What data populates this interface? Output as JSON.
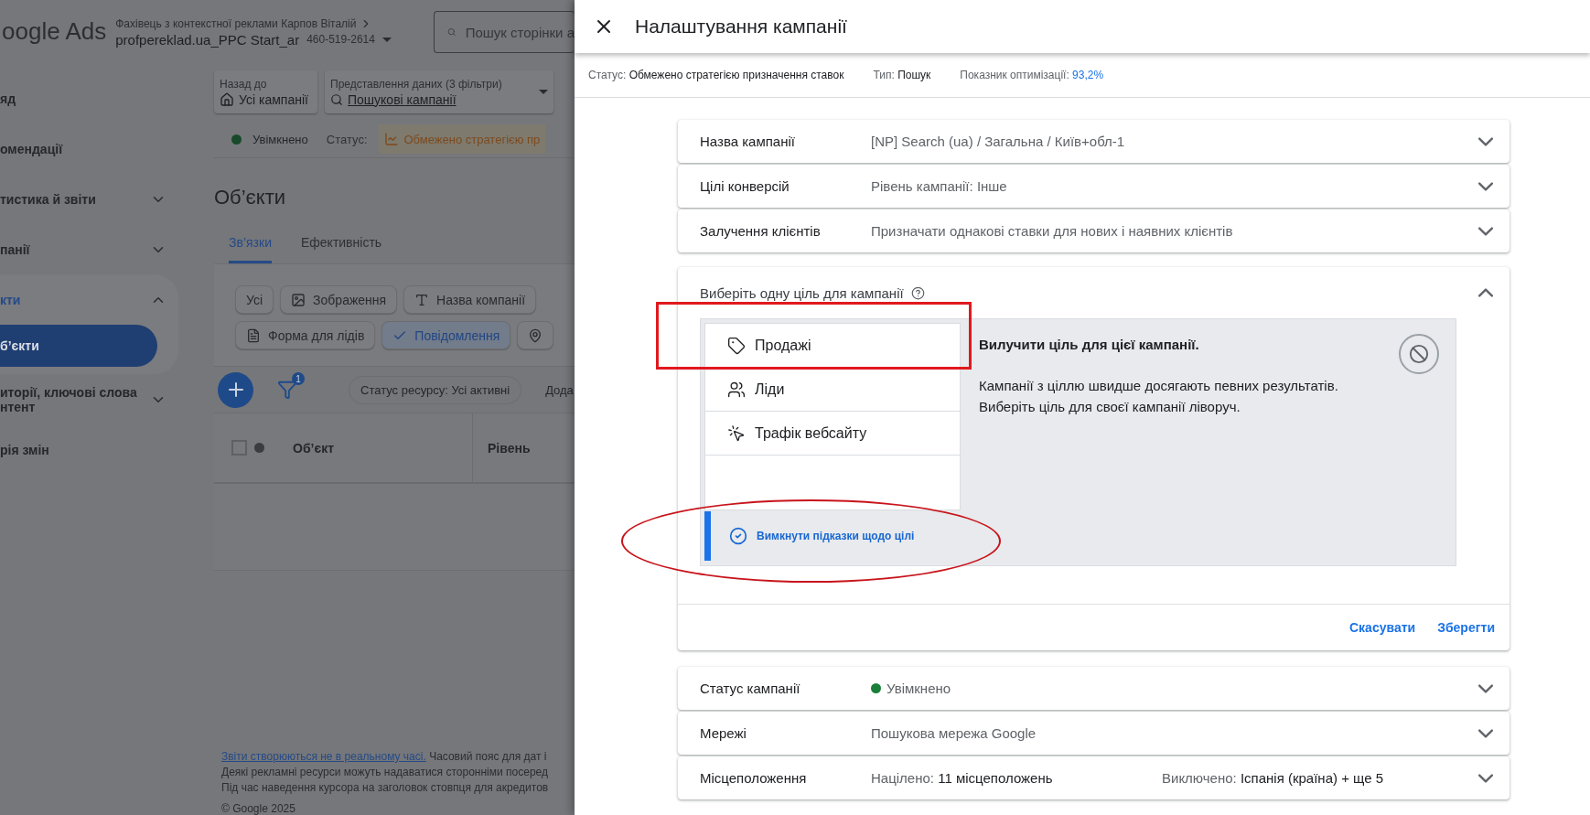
{
  "background_page": {
    "header": {
      "logo": "oogle Ads",
      "account_path": "Фахівець з контекстної реклами Карпов Віталій",
      "account_name": "profpereklad.ua_PPC Start_ar",
      "account_id": "460-519-2614",
      "search": {
        "placeholder": "Пошук сторінки а"
      }
    },
    "sidebar": {
      "items": [
        {
          "label": "яд"
        },
        {
          "label": "омендації"
        },
        {
          "label": "тистика й звіти",
          "expanded": false
        },
        {
          "label": "панії",
          "expanded": false
        },
        {
          "label": "кти",
          "expanded": true,
          "children": [
            {
              "label": "б’єкти",
              "selected": true
            }
          ]
        },
        {
          "label": "иторії, ключові слова нтент",
          "expanded": false
        },
        {
          "label": "рія змін"
        }
      ]
    },
    "main": {
      "back_to": {
        "label": "Назад до",
        "value": "Усі кампанії"
      },
      "data_view": {
        "label": "Представлення даних (3 фільтри)",
        "value": "Пошукові кампанії"
      },
      "campaign_status": "Увімкнено",
      "status_label": "Статус:",
      "status_value": "Обмежено стратегією пр",
      "heading": "Об’єкти",
      "tabs": [
        {
          "label": "Зв’язки",
          "selected": true
        },
        {
          "label": "Ефективність",
          "selected": false
        }
      ],
      "chip_rows": [
        [
          {
            "label": "Усі",
            "kind": "plain",
            "selected": false
          },
          {
            "label": "Зображення",
            "kind": "image",
            "selected": false
          },
          {
            "label": "Назва компанії",
            "kind": "text",
            "selected": false
          }
        ],
        [
          {
            "label": "Форма для лідів",
            "kind": "form",
            "selected": false
          },
          {
            "label": "Повідомлення",
            "selected": true
          },
          {
            "kind": "location",
            "selected": false
          }
        ]
      ],
      "filter_badge": "1",
      "resource_filter": "Статус ресурсу: Усі активні",
      "add_label": "Дода",
      "table": {
        "select_all": {
          "checked": false
        },
        "columns": [
          "Об’єкт",
          "Рівень"
        ]
      },
      "footer": {
        "link": "Звіти створюються не в реальному часі.",
        "link_tail": "Часовий пояс для дат і",
        "lines": [
          "Деякі рекламні ресурси можуть надаватися сторонніми посеред",
          "Під час наведення курсора на заголовок стовпця для акредитов"
        ],
        "copyright": "© Google 2025"
      }
    }
  },
  "panel": {
    "title": "Налаштування кампанії",
    "summary": [
      {
        "label": "Статус:",
        "value": "Обмежено стратегією призначення ставок",
        "kind": "text"
      },
      {
        "label": "Тип:",
        "value": "Пошук",
        "kind": "text"
      },
      {
        "label": "Показник оптимізації:",
        "value": "93,2%",
        "kind": "link"
      }
    ],
    "sections": [
      {
        "kind": "row",
        "name": "Назва кампанії",
        "value": "[NP] Search (ua) / Загальна / Київ+обл-1",
        "expanded": false
      },
      {
        "kind": "row",
        "name": "Цілі конверсій",
        "value": "Рівень кампанії: Інше",
        "expanded": false
      },
      {
        "kind": "row",
        "name": "Залучення клієнтів",
        "value": "Призначати однакові ставки для нових і наявних клієнтів",
        "expanded": false
      },
      {
        "kind": "goal",
        "title": "Виберіть одну ціль для кампанії",
        "expanded": true,
        "options": [
          {
            "label": "Продажі",
            "kind": "tag",
            "selected": false
          },
          {
            "label": "Ліди",
            "kind": "people",
            "selected": false
          },
          {
            "label": "Трафік вебсайту",
            "kind": "click",
            "selected": false
          }
        ],
        "hint_toggle": "Вимкнути підказки щодо цілі",
        "info_title": "Вилучити ціль для цієї кампанії.",
        "info_lines": [
          "Кампанії з ціллю швидше досягають певних результатів.",
          "Виберіть ціль для своєї кампанії ліворуч."
        ],
        "actions": [
          "Скасувати",
          "Зберегти"
        ]
      },
      {
        "kind": "status",
        "name": "Статус кампанії",
        "value": "Увімкнено",
        "color": "#188038",
        "expanded": false
      },
      {
        "kind": "row",
        "name": "Мережі",
        "value": "Пошукова мережа Google",
        "expanded": false
      },
      {
        "kind": "split",
        "name": "Місцеположення",
        "value_label": "Націлено:",
        "value": "11 місцеположень",
        "right_label": "Виключено:",
        "right_value": "Іспанія (країна) + ще 5",
        "expanded": false
      }
    ],
    "annotations": [
      {
        "kind": "rectangle"
      },
      {
        "kind": "ellipse"
      }
    ]
  }
}
